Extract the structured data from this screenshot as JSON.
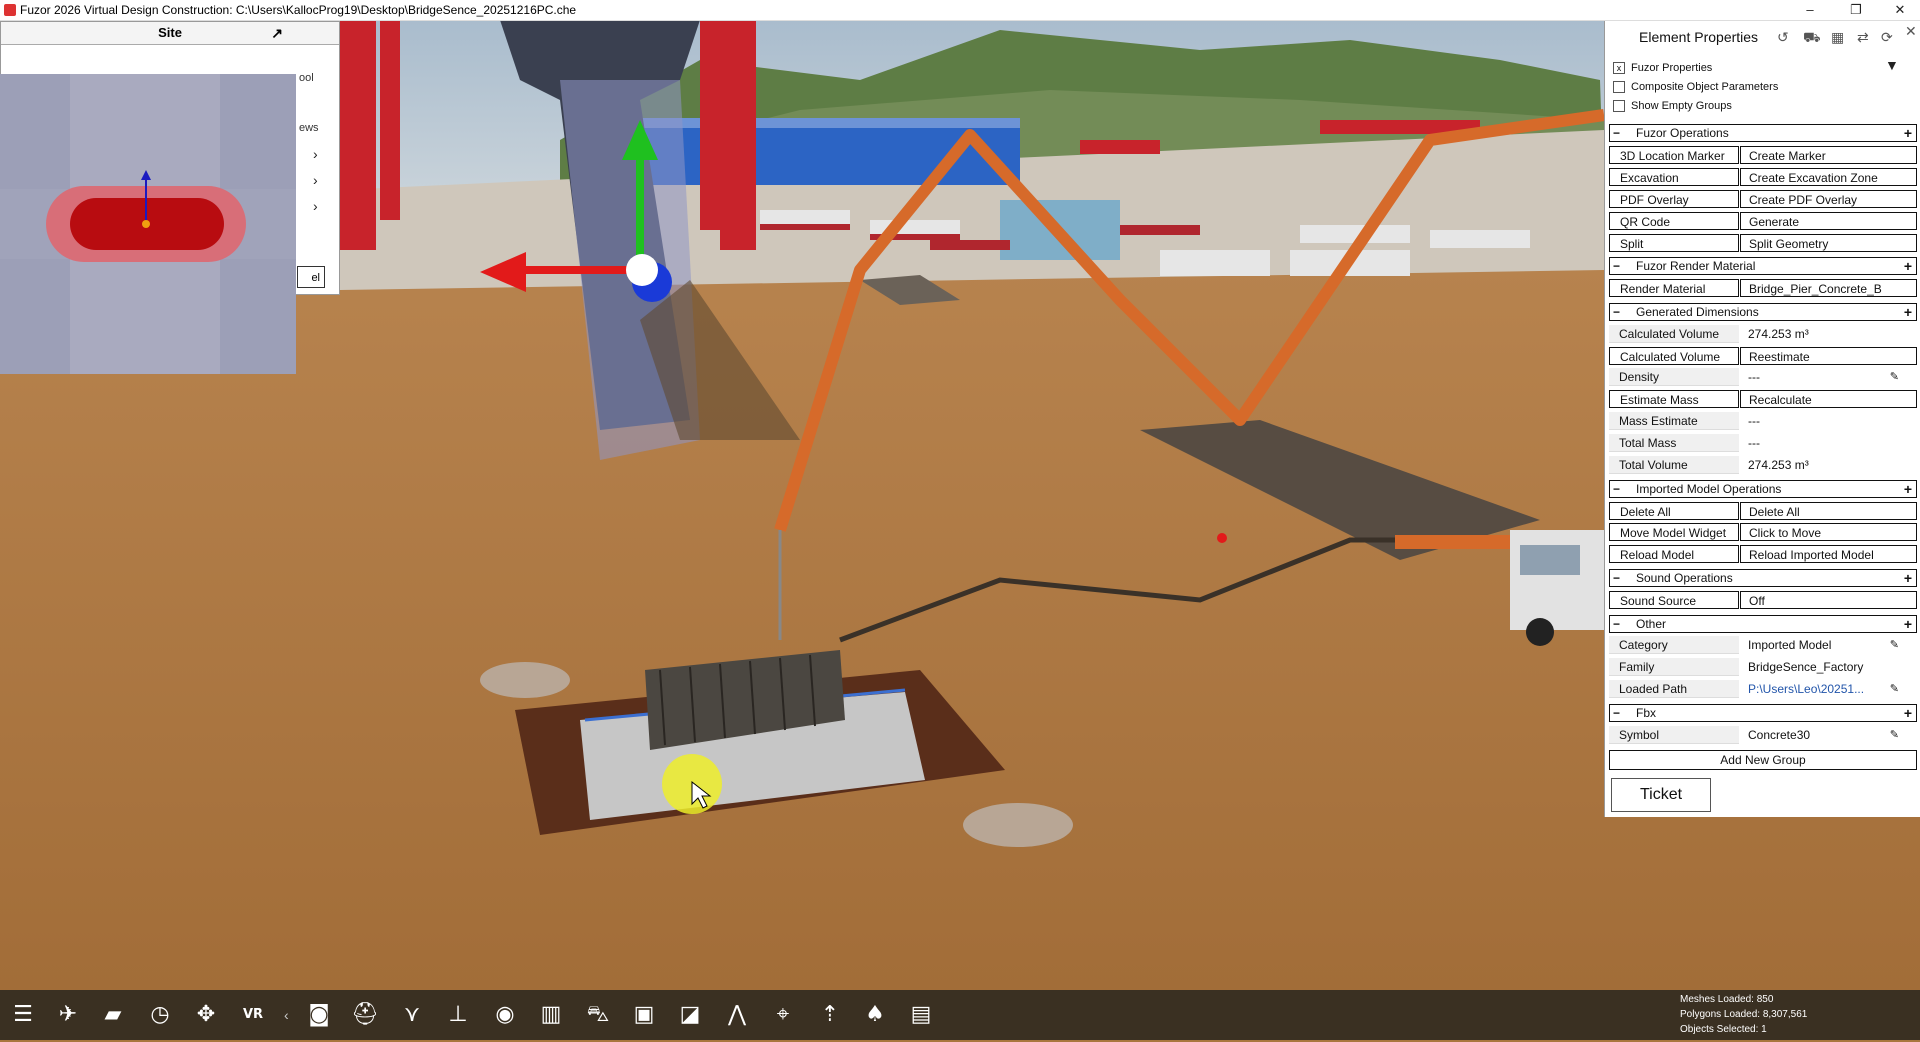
{
  "window": {
    "title": "Fuzor 2026 Virtual Design Construction: C:\\Users\\KallocProg19\\Desktop\\BridgeSence_20251216PC.che",
    "minimize": "–",
    "maximize": "❐",
    "close": "✕"
  },
  "site_panel": {
    "title": "Site",
    "expand": "↗",
    "trunc_text_1": "ool",
    "trunc_text_2": "ews",
    "chevron": "›",
    "button_fragment": "el"
  },
  "properties": {
    "title": "Element Properties",
    "checkboxes": [
      {
        "label": "Fuzor Properties",
        "checked": "x"
      },
      {
        "label": "Composite Object Parameters",
        "checked": ""
      },
      {
        "label": "Show Empty Groups",
        "checked": ""
      }
    ],
    "groups": {
      "fuzor_operations": "Fuzor Operations",
      "fuzor_render_material": "Fuzor Render Material",
      "generated_dimensions": "Generated Dimensions",
      "imported_model_operations": "Imported Model Operations",
      "sound_operations": "Sound Operations",
      "other": "Other",
      "fbx": "Fbx"
    },
    "rows": {
      "loc_marker": {
        "k": "3D Location Marker",
        "v": "Create Marker"
      },
      "excavation": {
        "k": "Excavation",
        "v": "Create Excavation Zone"
      },
      "pdf_overlay": {
        "k": "PDF Overlay",
        "v": "Create PDF Overlay"
      },
      "qr_code": {
        "k": "QR Code",
        "v": "Generate"
      },
      "split": {
        "k": "Split",
        "v": "Split Geometry"
      },
      "render_material": {
        "k": "Render Material",
        "v": "Bridge_Pier_Concrete_B"
      },
      "calc_volume_1": {
        "k": "Calculated Volume",
        "v": "274.253 m³"
      },
      "calc_volume_2": {
        "k": "Calculated Volume",
        "v": "Reestimate"
      },
      "density": {
        "k": "Density",
        "v": "---"
      },
      "estimate_mass": {
        "k": "Estimate Mass",
        "v": "Recalculate"
      },
      "mass_estimate": {
        "k": "Mass Estimate",
        "v": "---"
      },
      "total_mass": {
        "k": "Total Mass",
        "v": "---"
      },
      "total_volume": {
        "k": "Total Volume",
        "v": "274.253 m³"
      },
      "delete_all": {
        "k": "Delete All",
        "v": "Delete All"
      },
      "move_model": {
        "k": "Move Model Widget",
        "v": "Click to Move"
      },
      "reload_model": {
        "k": "Reload Model",
        "v": "Reload Imported Model"
      },
      "sound_source": {
        "k": "Sound Source",
        "v": "Off"
      },
      "category": {
        "k": "Category",
        "v": "Imported Model"
      },
      "family": {
        "k": "Family",
        "v": "BridgeSence_Factory"
      },
      "loaded_path": {
        "k": "Loaded Path",
        "v": "P:\\Users\\Leo\\20251..."
      },
      "symbol": {
        "k": "Symbol",
        "v": "Concrete30"
      }
    },
    "add_group": "Add New Group",
    "ticket": "Ticket"
  },
  "toolbar": {
    "icons": [
      "list-icon",
      "drone-icon",
      "folder-icon",
      "clock-icon",
      "move-icon",
      "vr-icon",
      "camera-icon",
      "helmet-icon",
      "graph-icon",
      "pin-icon",
      "eye-icon",
      "building-icon",
      "car-icon",
      "film-icon",
      "image-icon",
      "path-icon",
      "map-marker-icon",
      "crane-icon",
      "tree-icon",
      "clipboard-icon"
    ],
    "vr_label": "VR",
    "collapse": "‹"
  },
  "stats": {
    "meshes": "Meshes Loaded: 850",
    "polygons": "Polygons Loaded: 8,307,561",
    "selected": "Objects Selected: 1"
  },
  "colors": {
    "ground": "#a9763e",
    "sky": "#b7c7d6",
    "crane_red": "#c8232b",
    "boom_orange": "#d66a2a",
    "gizmo_green": "#1fc01f",
    "gizmo_red": "#e21a1a",
    "gizmo_blue": "#1a3ad8",
    "toolbar_bg": "#3a3022"
  }
}
